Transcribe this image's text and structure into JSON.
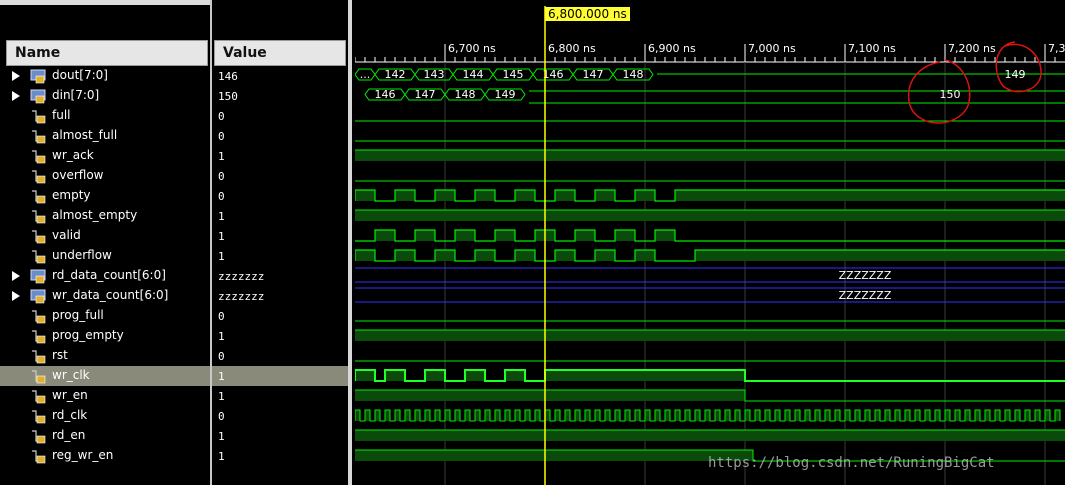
{
  "columns": {
    "name": "Name",
    "value": "Value"
  },
  "cursor": {
    "label": "6,800.000 ns"
  },
  "timeline": {
    "ticks": [
      "6,700 ns",
      "6,800 ns",
      "6,900 ns",
      "7,000 ns",
      "7,100 ns",
      "7,200 ns",
      "7,3"
    ]
  },
  "signals": [
    {
      "name": "dout[7:0]",
      "value": "146",
      "bus": true
    },
    {
      "name": "din[7:0]",
      "value": "150",
      "bus": true
    },
    {
      "name": "full",
      "value": "0"
    },
    {
      "name": "almost_full",
      "value": "0"
    },
    {
      "name": "wr_ack",
      "value": "1"
    },
    {
      "name": "overflow",
      "value": "0"
    },
    {
      "name": "empty",
      "value": "0"
    },
    {
      "name": "almost_empty",
      "value": "1"
    },
    {
      "name": "valid",
      "value": "1"
    },
    {
      "name": "underflow",
      "value": "1"
    },
    {
      "name": "rd_data_count[6:0]",
      "value": "zzzzzzz",
      "bus": true
    },
    {
      "name": "wr_data_count[6:0]",
      "value": "zzzzzzz",
      "bus": true
    },
    {
      "name": "prog_full",
      "value": "0"
    },
    {
      "name": "prog_empty",
      "value": "1"
    },
    {
      "name": "rst",
      "value": "0"
    },
    {
      "name": "wr_clk",
      "value": "1",
      "selected": true
    },
    {
      "name": "wr_en",
      "value": "1"
    },
    {
      "name": "rd_clk",
      "value": "0"
    },
    {
      "name": "rd_en",
      "value": "1"
    },
    {
      "name": "reg_wr_en",
      "value": "1"
    }
  ],
  "bus_values": {
    "dout": [
      "...",
      "142",
      "143",
      "144",
      "145",
      "146",
      "147",
      "148",
      "149"
    ],
    "din": [
      "146",
      "147",
      "148",
      "149",
      "150"
    ],
    "rd_data_count": "ZZZZZZZ",
    "wr_data_count": "ZZZZZZZ"
  },
  "watermark": "https://blog.csdn.net/RuningBigCat",
  "colors": {
    "wave": "#00ee00",
    "fill": "#0a4a0a",
    "cursor": "#ffff00",
    "zbus": "#3030ff",
    "annot": "#dd1111"
  }
}
